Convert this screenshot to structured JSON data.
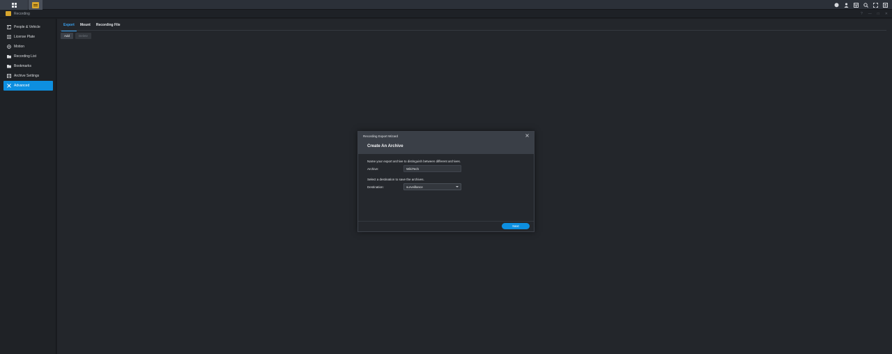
{
  "taskbar": {
    "apps_icon": "grid-icon",
    "recording_icon": "recording-app-icon",
    "right_icons": [
      "chat-icon",
      "user-icon",
      "widgets-icon",
      "search-icon",
      "fullscreen-icon",
      "menu-icon"
    ]
  },
  "window": {
    "title": "Recording",
    "controls": [
      "?",
      "—",
      "□",
      "✕"
    ]
  },
  "sidebar": {
    "items": [
      {
        "label": "People & Vehicle",
        "icon": "people-vehicle-icon",
        "active": false
      },
      {
        "label": "License Plate",
        "icon": "license-plate-icon",
        "active": false
      },
      {
        "label": "Motion",
        "icon": "motion-icon",
        "active": false
      },
      {
        "label": "Recording List",
        "icon": "recording-list-icon",
        "active": false
      },
      {
        "label": "Bookmarks",
        "icon": "bookmark-icon",
        "active": false
      },
      {
        "label": "Archive Settings",
        "icon": "archive-settings-icon",
        "active": false
      },
      {
        "label": "Advanced",
        "icon": "advanced-icon",
        "active": true
      }
    ]
  },
  "main": {
    "tabs": [
      {
        "label": "Export",
        "active": true
      },
      {
        "label": "Mount",
        "active": false
      },
      {
        "label": "Recording File",
        "active": false
      }
    ],
    "toolbar": {
      "add_label": "Add",
      "delete_label": "Delete"
    }
  },
  "modal": {
    "title": "Recording Export Wizard",
    "subtitle": "Create An Archive",
    "archive_desc": "Name your export archive to distinguish between different archives.",
    "archive_label": "Archive:",
    "archive_value": "WikiTech",
    "destination_desc": "Select a destination to save the archives.",
    "destination_label": "Destination:",
    "destination_value": "surveillance",
    "next_label": "Next"
  },
  "colors": {
    "accent": "#0d8fe0",
    "active_tab": "#3aa1ee",
    "app_icon": "#d7a52d"
  }
}
